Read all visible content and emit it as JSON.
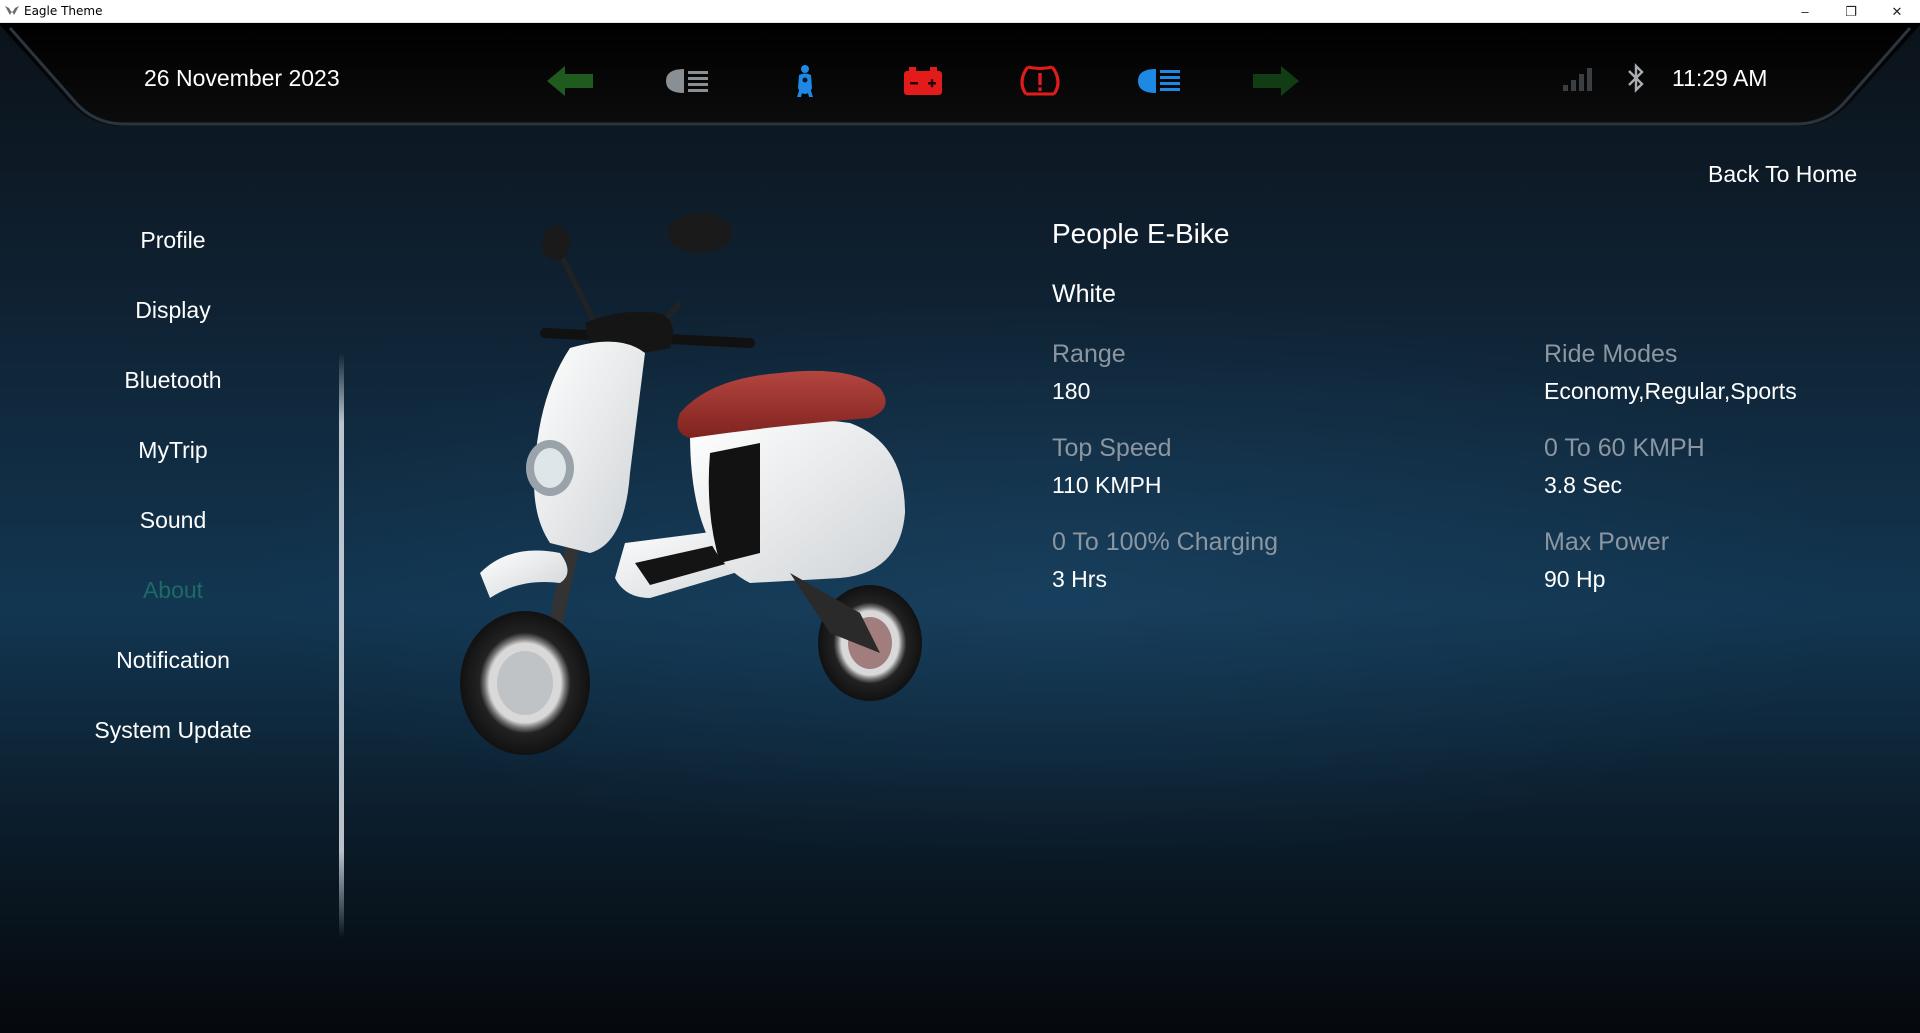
{
  "window": {
    "title": "Eagle Theme",
    "controls": {
      "minimize": "–",
      "restore": "❐",
      "close": "✕"
    }
  },
  "status_bar": {
    "date": "26 November 2023",
    "time": "11:29 AM",
    "indicators": [
      {
        "icon": "left-turn-arrow-icon",
        "color": "#1f5a1f"
      },
      {
        "icon": "low-beam-icon",
        "color": "#8a8f94"
      },
      {
        "icon": "side-stand-rider-icon",
        "color": "#1e88e5"
      },
      {
        "icon": "battery-warning-icon",
        "color": "#e41b1b"
      },
      {
        "icon": "tire-pressure-warning-icon",
        "color": "#e41b1b"
      },
      {
        "icon": "high-beam-icon",
        "color": "#1e88e5"
      },
      {
        "icon": "right-turn-arrow-icon",
        "color": "#123d14"
      }
    ]
  },
  "back_link": "Back To Home",
  "menu": {
    "items": [
      {
        "label": "Profile"
      },
      {
        "label": "Display"
      },
      {
        "label": "Bluetooth"
      },
      {
        "label": "MyTrip"
      },
      {
        "label": "Sound"
      },
      {
        "label": "About",
        "active": true
      },
      {
        "label": "Notification"
      },
      {
        "label": "System Update"
      }
    ],
    "active_color": "#1c6b66"
  },
  "vehicle": {
    "model": "People E-Bike",
    "color": "White",
    "specs": [
      {
        "label": "Range",
        "value": "180"
      },
      {
        "label": "Ride Modes",
        "value": "Economy,Regular,Sports"
      },
      {
        "label": "Top Speed",
        "value": "110 KMPH"
      },
      {
        "label": "0 To 60 KMPH",
        "value": "3.8 Sec"
      },
      {
        "label": "0 To 100% Charging",
        "value": "3 Hrs"
      },
      {
        "label": "Max Power",
        "value": "90 Hp"
      }
    ]
  }
}
